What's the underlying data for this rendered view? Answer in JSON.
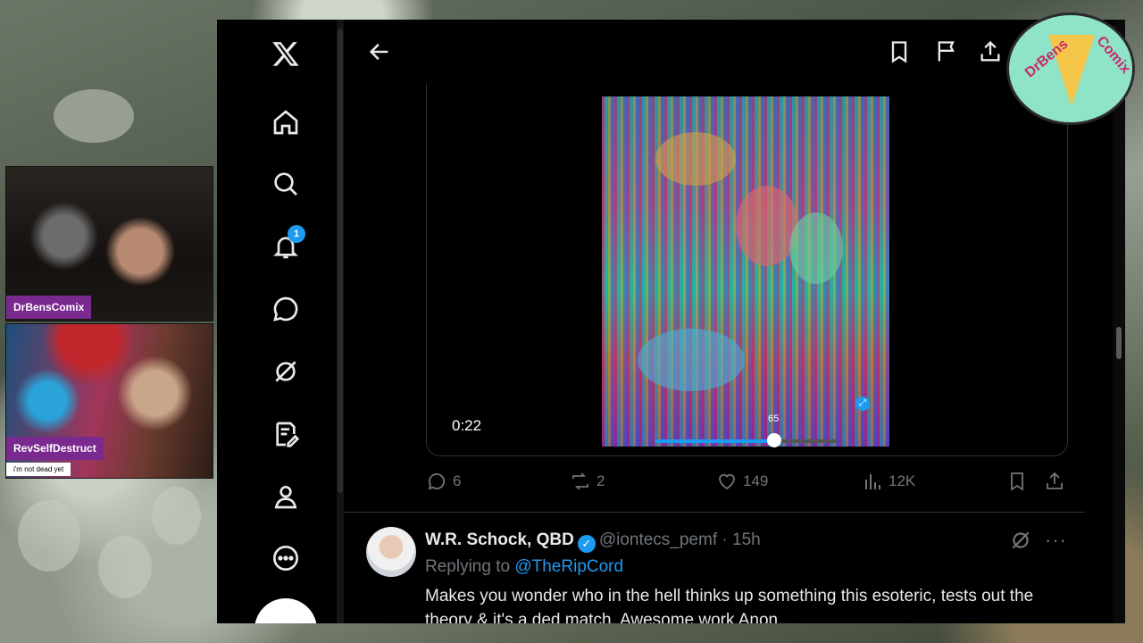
{
  "webcams": [
    {
      "name_tag": "DrBensComix"
    },
    {
      "name_tag": "RevSelfDestruct",
      "subtitle": "i'm not dead yet"
    }
  ],
  "logo": {
    "left_text": "DrBens",
    "right_text": "Comix"
  },
  "nav": {
    "items": [
      "x-logo",
      "home",
      "search",
      "notifications",
      "messages",
      "grok",
      "lists",
      "profile",
      "more"
    ],
    "notification_count": "1"
  },
  "topbar": {
    "icons": [
      "back-arrow",
      "bookmark",
      "report-flag",
      "share"
    ]
  },
  "video": {
    "elapsed": "0:22",
    "volume_tooltip": "65",
    "scrub_progress": 0.63
  },
  "tweet_actions": {
    "replies": "6",
    "reposts": "2",
    "likes": "149",
    "views": "12K"
  },
  "reply": {
    "display_name": "W.R. Schock, QBD",
    "handle": "@iontecs_pemf",
    "age": "· 15h",
    "replying_prefix": "Replying to",
    "replying_to": "@TheRipCord",
    "text": "Makes you wonder who in the hell thinks up something this esoteric, tests out the theory & it's a ded match. Awesome work Anon."
  },
  "colors": {
    "accent": "#1d9bf0",
    "muted": "#71767b",
    "text": "#e7e9ea",
    "cam_label": "#7a2a8f"
  }
}
